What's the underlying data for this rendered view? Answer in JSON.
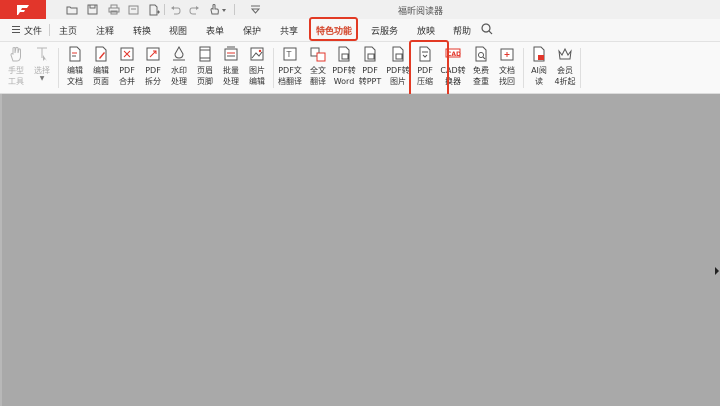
{
  "app_title": "福昕阅读器",
  "menu": {
    "file_label": "文件"
  },
  "tabs": [
    {
      "label": "主页"
    },
    {
      "label": "注释"
    },
    {
      "label": "转换"
    },
    {
      "label": "视图"
    },
    {
      "label": "表单"
    },
    {
      "label": "保护"
    },
    {
      "label": "共享"
    },
    {
      "label": "特色功能"
    },
    {
      "label": "云服务"
    },
    {
      "label": "放映"
    },
    {
      "label": "帮助"
    }
  ],
  "active_tab": "特色功能",
  "tools": [
    {
      "line1": "手型",
      "line2": "工具",
      "icon": "hand-icon"
    },
    {
      "line1": "选择",
      "line2": "",
      "icon": "select-cursor-icon"
    },
    {
      "line1": "编辑",
      "line2": "文档",
      "icon": "edit-document-icon"
    },
    {
      "line1": "编辑",
      "line2": "页面",
      "icon": "edit-page-icon"
    },
    {
      "line1": "PDF",
      "line2": "合并",
      "icon": "merge-icon"
    },
    {
      "line1": "PDF",
      "line2": "拆分",
      "icon": "split-icon"
    },
    {
      "line1": "水印",
      "line2": "处理",
      "icon": "watermark-icon"
    },
    {
      "line1": "页眉",
      "line2": "页脚",
      "icon": "header-footer-icon"
    },
    {
      "line1": "批量",
      "line2": "处理",
      "icon": "batch-icon"
    },
    {
      "line1": "图片",
      "line2": "编辑",
      "icon": "image-edit-icon"
    },
    {
      "line1": "PDF文",
      "line2": "档翻译",
      "icon": "translate-doc-icon"
    },
    {
      "line1": "全文",
      "line2": "翻译",
      "icon": "full-translate-icon"
    },
    {
      "line1": "PDF转",
      "line2": "Word",
      "icon": "pdf-to-word-icon"
    },
    {
      "line1": "PDF",
      "line2": "转PPT",
      "icon": "pdf-to-ppt-icon"
    },
    {
      "line1": "PDF转",
      "line2": "图片",
      "icon": "pdf-to-image-icon"
    },
    {
      "line1": "PDF",
      "line2": "压缩",
      "icon": "compress-icon"
    },
    {
      "line1": "CAD转",
      "line2": "换器",
      "icon": "cad-icon"
    },
    {
      "line1": "免费",
      "line2": "查重",
      "icon": "plagiarism-check-icon"
    },
    {
      "line1": "文档",
      "line2": "找回",
      "icon": "recover-icon"
    },
    {
      "line1": "AI阅",
      "line2": "读",
      "icon": "ai-read-icon"
    },
    {
      "line1": "会员",
      "line2": "4折起",
      "icon": "crown-icon"
    }
  ],
  "colors": {
    "accent": "#e23a24",
    "active_tab": "#d4472c",
    "doc_bg": "#a9a9a9"
  }
}
